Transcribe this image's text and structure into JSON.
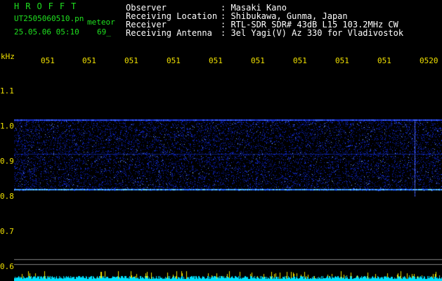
{
  "app": {
    "title": "HROFFT",
    "file_name": "UT2505060510.pn",
    "mode": "meteor",
    "timestamp": "25.05.06 05:10",
    "count": "69_"
  },
  "info": [
    {
      "label": "Observer",
      "value": ": Masaki Kano"
    },
    {
      "label": "Receiving Location",
      "value": ": Shibukawa, Gunma, Japan"
    },
    {
      "label": "Receiver",
      "value": ": RTL-SDR SDR# 43dB L15 103.2MHz CW"
    },
    {
      "label": "Receiving Antenna",
      "value": ": 3el Yagi(V) Az 330 for Vladivostok"
    }
  ],
  "time_ticks": [
    "051",
    "051",
    "051",
    "051",
    "051",
    "051",
    "051",
    "051",
    "051",
    "0520"
  ],
  "axis": {
    "unit": "kHz",
    "ticks": [
      "1.1",
      "1.0",
      "0.9",
      "0.8",
      "0.7",
      "0.6"
    ]
  },
  "colors": {
    "background": "#000000",
    "header_green": "#1fe01f",
    "tick_yellow": "#f0e000",
    "signal_blue": "#1428ff",
    "noise_cyan": "#00e5ff"
  }
}
